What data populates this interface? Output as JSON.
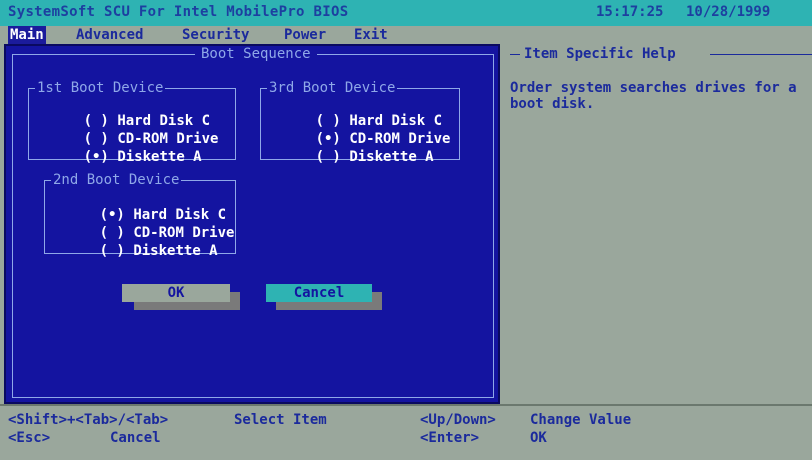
{
  "titlebar": {
    "title": "SystemSoft SCU For Intel MobilePro BIOS",
    "time": "15:17:25",
    "date": "10/28/1999"
  },
  "menu": {
    "items": [
      "Main",
      "Advanced",
      "Security",
      "Power",
      "Exit"
    ]
  },
  "dialog": {
    "title": "Boot Sequence",
    "groups": [
      {
        "title": "1st Boot Device",
        "options": [
          {
            "mark": "( )",
            "label": "Hard Disk C"
          },
          {
            "mark": "( )",
            "label": "CD-ROM Drive"
          },
          {
            "mark": "(•)",
            "label": "Diskette A"
          }
        ]
      },
      {
        "title": "2nd Boot Device",
        "options": [
          {
            "mark": "(•)",
            "label": "Hard Disk C"
          },
          {
            "mark": "( )",
            "label": "CD-ROM Drive"
          },
          {
            "mark": "( )",
            "label": "Diskette A"
          }
        ]
      },
      {
        "title": "3rd Boot Device",
        "options": [
          {
            "mark": "( )",
            "label": "Hard Disk C"
          },
          {
            "mark": "(•)",
            "label": "CD-ROM Drive"
          },
          {
            "mark": "( )",
            "label": "Diskette A"
          }
        ]
      }
    ],
    "ok_label": "OK",
    "cancel_label": "Cancel"
  },
  "help": {
    "title": "Item Specific Help",
    "text": "Order system searches drives for a boot disk."
  },
  "status": {
    "key1": "<Shift>+<Tab>/<Tab>",
    "action1": "Select Item",
    "key2": "<Esc>",
    "action2": "Cancel",
    "key3": "<Up/Down>",
    "action3": "Change Value",
    "key4": "<Enter>",
    "action4": "OK"
  },
  "colors": {
    "dialog_bg": "#1414a0",
    "title_bar": "#2eb3b3",
    "panel_bg": "#9aa79c",
    "text_blue": "#1b2a9c"
  }
}
